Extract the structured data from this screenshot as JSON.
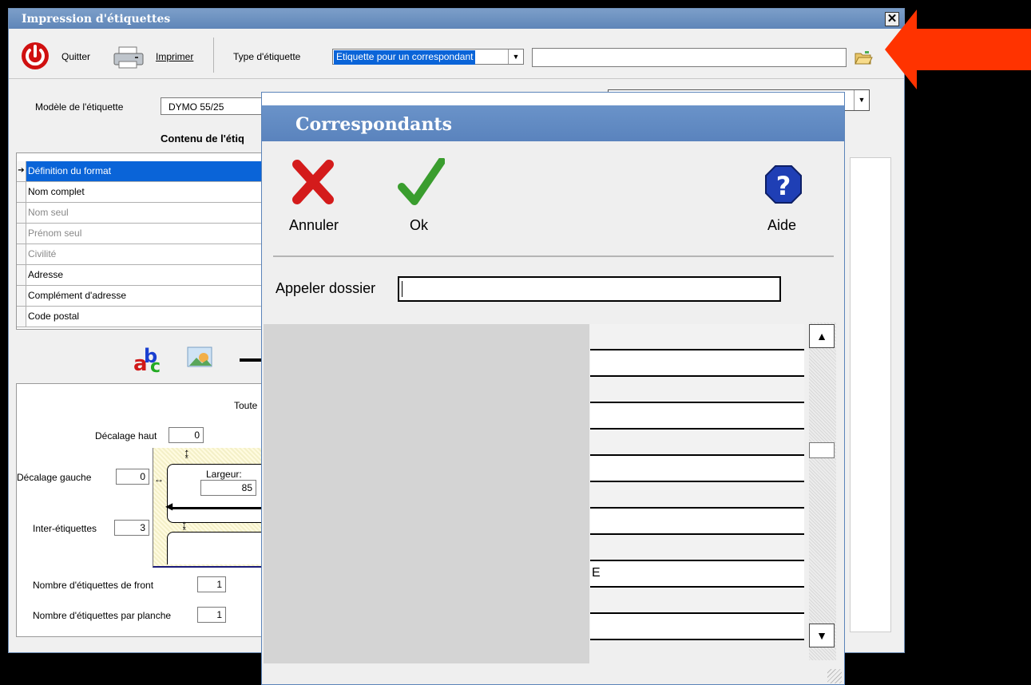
{
  "window": {
    "title": "Impression d'étiquettes"
  },
  "toolbar": {
    "quit_label": "Quitter",
    "print_label": "Imprimer",
    "label_type_caption": "Type d'étiquette",
    "label_type_value": "Etiquette pour un correspondant",
    "correspondent_value": ""
  },
  "model": {
    "caption": "Modèle de l'étiquette",
    "value": "DYMO 55/25"
  },
  "content": {
    "heading": "Contenu de l'étiq",
    "rows": [
      {
        "label": "Définition du format",
        "selected": true,
        "enabled": true
      },
      {
        "label": "Nom complet",
        "enabled": true
      },
      {
        "label": "Nom seul",
        "enabled": false
      },
      {
        "label": "Prénom seul",
        "enabled": false
      },
      {
        "label": "Civilité",
        "enabled": false
      },
      {
        "label": "Adresse",
        "enabled": true
      },
      {
        "label": "Complément d'adresse",
        "enabled": true
      },
      {
        "label": "Code postal",
        "enabled": true
      }
    ]
  },
  "layout": {
    "all_caption": "Toute",
    "top_offset_label": "Décalage haut",
    "top_offset": "0",
    "left_offset_label": "Décalage gauche",
    "left_offset": "0",
    "width_label": "Largeur:",
    "width": "85",
    "inter_label": "Inter-étiquettes",
    "inter": "3",
    "front_count_label": "Nombre d'étiquettes de front",
    "front_count": "1",
    "sheet_count_label": "Nombre d'étiquettes par planche",
    "sheet_count": "1"
  },
  "dialog": {
    "title": "Correspondants",
    "cancel_label": "Annuler",
    "ok_label": "Ok",
    "help_label": "Aide",
    "search_label": "Appeler dossier",
    "search_value": "",
    "list_rows": [
      "",
      "",
      "",
      "",
      "",
      "",
      "",
      "",
      "",
      "E",
      "",
      ""
    ]
  },
  "colors": {
    "accent_arrow": "#ff3300",
    "title_blue": "#5f86b8",
    "selection": "#0a64d8"
  }
}
